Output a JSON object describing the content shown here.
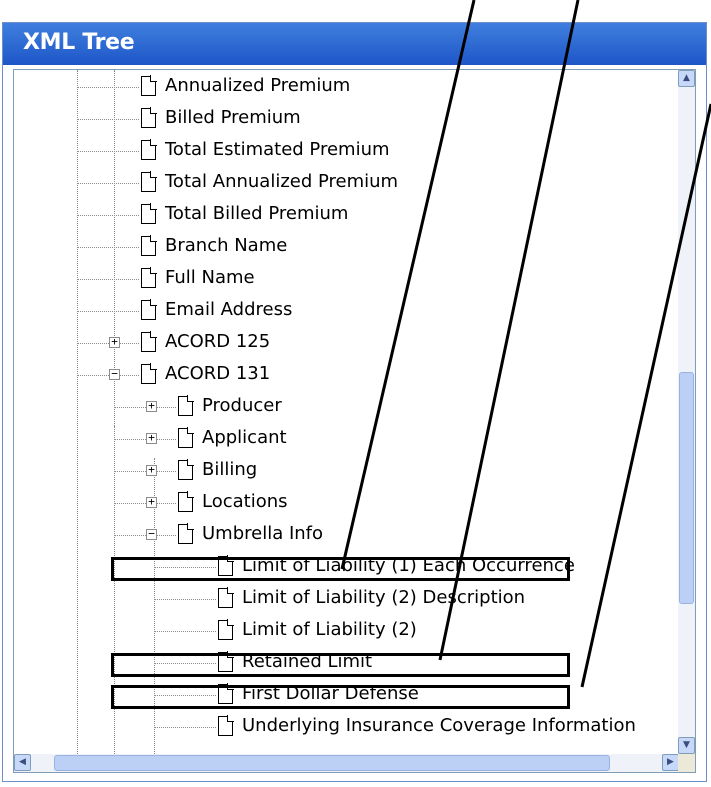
{
  "window": {
    "title": "XML Tree"
  },
  "tree": {
    "nodes": [
      {
        "label": "Annualized Premium",
        "depth": 0,
        "toggle": ""
      },
      {
        "label": "Billed Premium",
        "depth": 0,
        "toggle": ""
      },
      {
        "label": "Total Estimated Premium",
        "depth": 0,
        "toggle": ""
      },
      {
        "label": "Total Annualized Premium",
        "depth": 0,
        "toggle": ""
      },
      {
        "label": "Total Billed Premium",
        "depth": 0,
        "toggle": ""
      },
      {
        "label": "Branch Name",
        "depth": 0,
        "toggle": ""
      },
      {
        "label": "Full Name",
        "depth": 0,
        "toggle": ""
      },
      {
        "label": "Email Address",
        "depth": 0,
        "toggle": ""
      },
      {
        "label": "ACORD 125",
        "depth": 0,
        "toggle": "+"
      },
      {
        "label": "ACORD 131",
        "depth": 0,
        "toggle": "−"
      },
      {
        "label": "Producer",
        "depth": 1,
        "toggle": "+"
      },
      {
        "label": "Applicant",
        "depth": 1,
        "toggle": "+"
      },
      {
        "label": "Billing",
        "depth": 1,
        "toggle": "+"
      },
      {
        "label": "Locations",
        "depth": 1,
        "toggle": "+"
      },
      {
        "label": "Umbrella Info",
        "depth": 1,
        "toggle": "−"
      },
      {
        "label": "Limit of Liability (1) Each Occurrence",
        "depth": 2,
        "toggle": "",
        "highlighted": true
      },
      {
        "label": "Limit of Liability (2) Description",
        "depth": 2,
        "toggle": ""
      },
      {
        "label": "Limit of Liability (2)",
        "depth": 2,
        "toggle": ""
      },
      {
        "label": "Retained Limit",
        "depth": 2,
        "toggle": "",
        "highlighted": true
      },
      {
        "label": "First Dollar Defense",
        "depth": 2,
        "toggle": "",
        "highlighted": true
      },
      {
        "label": "Underlying Insurance Coverage Information",
        "depth": 2,
        "toggle": ""
      }
    ]
  },
  "scrollbars": {
    "up_arrow": "▲",
    "down_arrow": "▼",
    "left_arrow": "◀",
    "right_arrow": "▶",
    "vertical_position": 0.6,
    "horizontal_position": 0.05
  },
  "colors": {
    "titlebar": "#2a62d2",
    "highlight_border": "#000000"
  }
}
